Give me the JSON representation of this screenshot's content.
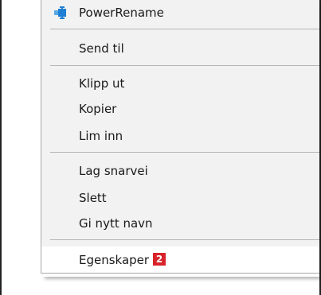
{
  "menu": {
    "items": [
      {
        "label": "PowerRename",
        "icon": "powerrename-icon"
      },
      {
        "label": "Send til"
      },
      {
        "label": "Klipp ut"
      },
      {
        "label": "Kopier"
      },
      {
        "label": "Lim inn"
      },
      {
        "label": "Lag snarvei"
      },
      {
        "label": "Slett"
      },
      {
        "label": "Gi nytt navn"
      },
      {
        "label": "Egenskaper",
        "badge": "2",
        "badge_color": "#d8232a",
        "highlighted": true
      }
    ]
  },
  "colors": {
    "menu_background": "#f2f2f2",
    "highlight": "#ffffff",
    "separator": "#b5b5b5",
    "icon_accent": "#1e7fd4"
  }
}
